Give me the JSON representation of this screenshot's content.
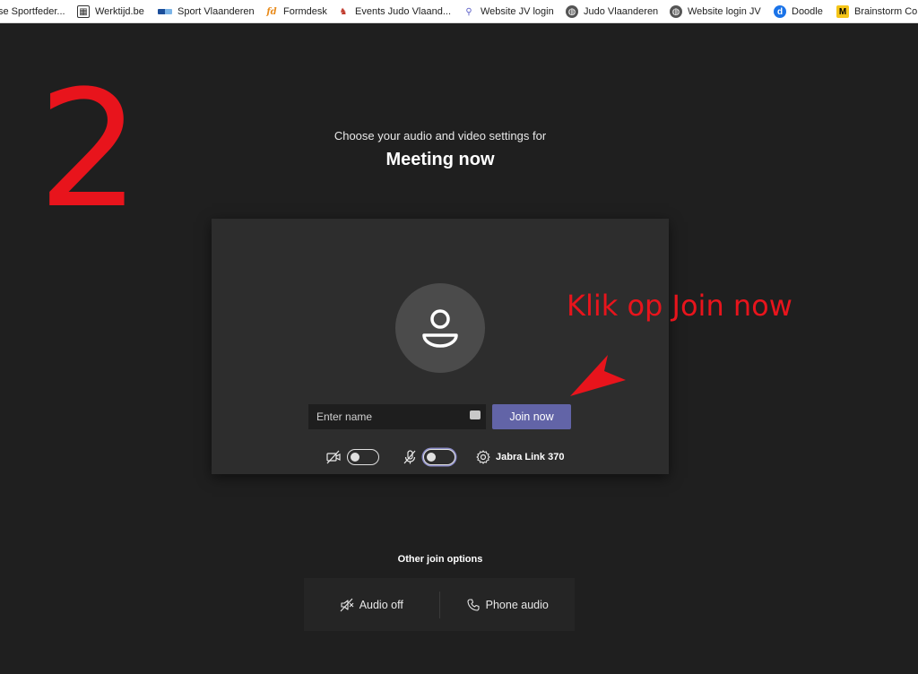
{
  "bookmarks": [
    {
      "label": "se Sportfeder...",
      "icon": "globe-icon"
    },
    {
      "label": "Werktijd.be",
      "icon": "calendar-icon"
    },
    {
      "label": "Sport Vlaanderen",
      "icon": "sport-vlaanderen-icon"
    },
    {
      "label": "Formdesk",
      "icon": "formdesk-icon"
    },
    {
      "label": "Events Judo Vlaand...",
      "icon": "events-icon"
    },
    {
      "label": "Website JV login",
      "icon": "person-icon"
    },
    {
      "label": "Judo Vlaanderen",
      "icon": "globe-icon"
    },
    {
      "label": "Website login JV",
      "icon": "globe-icon"
    },
    {
      "label": "Doodle",
      "icon": "doodle-icon"
    },
    {
      "label": "Brainstorm Cor",
      "icon": "brainstorm-icon"
    }
  ],
  "annotation": {
    "step_number": "2",
    "hint": "Klik op Join now",
    "color": "#e8141c"
  },
  "prejoin": {
    "subtitle": "Choose your audio and video settings for",
    "meeting_title": "Meeting now",
    "name_placeholder": "Enter name",
    "name_value": "",
    "join_label": "Join now",
    "camera_on": false,
    "mic_on": false,
    "device_label": "Jabra Link 370",
    "accent_color": "#6264a7"
  },
  "other_options": {
    "label": "Other join options",
    "audio_off": "Audio off",
    "phone_audio": "Phone audio"
  }
}
